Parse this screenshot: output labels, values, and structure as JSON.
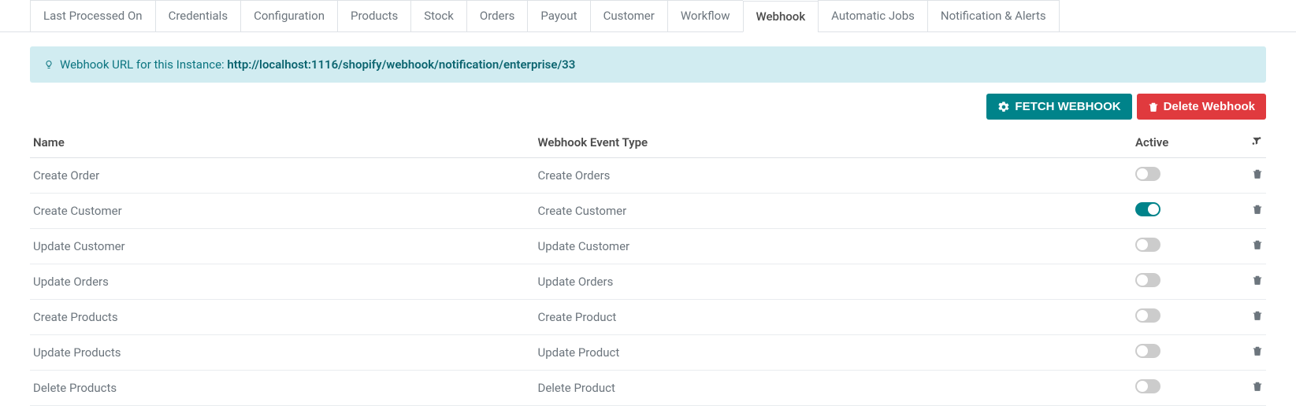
{
  "tabs": [
    {
      "label": "Last Processed On",
      "active": false
    },
    {
      "label": "Credentials",
      "active": false
    },
    {
      "label": "Configuration",
      "active": false
    },
    {
      "label": "Products",
      "active": false
    },
    {
      "label": "Stock",
      "active": false
    },
    {
      "label": "Orders",
      "active": false
    },
    {
      "label": "Payout",
      "active": false
    },
    {
      "label": "Customer",
      "active": false
    },
    {
      "label": "Workflow",
      "active": false
    },
    {
      "label": "Webhook",
      "active": true
    },
    {
      "label": "Automatic Jobs",
      "active": false
    },
    {
      "label": "Notification & Alerts",
      "active": false
    }
  ],
  "banner": {
    "prefix": "Webhook URL for this Instance: ",
    "url": "http://localhost:1116/shopify/webhook/notification/enterprise/33"
  },
  "buttons": {
    "fetch": "FETCH WEBHOOK",
    "delete": "Delete Webhook"
  },
  "table": {
    "headers": {
      "name": "Name",
      "event_type": "Webhook Event Type",
      "active": "Active"
    },
    "rows": [
      {
        "name": "Create Order",
        "event_type": "Create Orders",
        "active": false
      },
      {
        "name": "Create Customer",
        "event_type": "Create Customer",
        "active": true
      },
      {
        "name": "Update Customer",
        "event_type": "Update Customer",
        "active": false
      },
      {
        "name": "Update Orders",
        "event_type": "Update Orders",
        "active": false
      },
      {
        "name": "Create Products",
        "event_type": "Create Product",
        "active": false
      },
      {
        "name": "Update Products",
        "event_type": "Update Product",
        "active": false
      },
      {
        "name": "Delete Products",
        "event_type": "Delete Product",
        "active": false
      }
    ]
  }
}
